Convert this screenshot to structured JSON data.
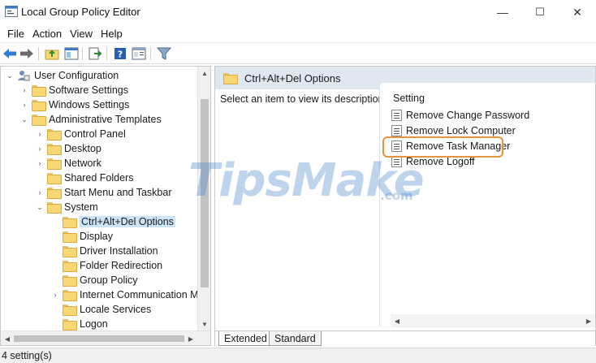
{
  "window": {
    "title": "Local Group Policy Editor",
    "minimize_glyph": "—",
    "maximize_glyph": "☐",
    "close_glyph": "✕"
  },
  "menu": {
    "file": "File",
    "action": "Action",
    "view": "View",
    "help": "Help"
  },
  "toolbar": {
    "icons": [
      "back-arrow-icon",
      "forward-arrow-icon",
      "up-folder-icon",
      "show-hide-tree-icon",
      "export-list-icon",
      "help-icon",
      "properties-icon",
      "filter-icon"
    ]
  },
  "tree": {
    "items": [
      {
        "label": "User Configuration",
        "expander": "⌄"
      },
      {
        "label": "Software Settings",
        "expander": "›"
      },
      {
        "label": "Windows Settings",
        "expander": "›"
      },
      {
        "label": "Administrative Templates",
        "expander": "⌄"
      },
      {
        "label": "Control Panel",
        "expander": "›"
      },
      {
        "label": "Desktop",
        "expander": "›"
      },
      {
        "label": "Network",
        "expander": "›"
      },
      {
        "label": "Shared Folders",
        "expander": ""
      },
      {
        "label": "Start Menu and Taskbar",
        "expander": "›"
      },
      {
        "label": "System",
        "expander": "⌄"
      },
      {
        "label": "Ctrl+Alt+Del Options",
        "expander": ""
      },
      {
        "label": "Display",
        "expander": ""
      },
      {
        "label": "Driver Installation",
        "expander": ""
      },
      {
        "label": "Folder Redirection",
        "expander": ""
      },
      {
        "label": "Group Policy",
        "expander": ""
      },
      {
        "label": "Internet Communication Ma",
        "expander": "›"
      },
      {
        "label": "Locale Services",
        "expander": ""
      },
      {
        "label": "Logon",
        "expander": ""
      }
    ]
  },
  "right": {
    "header_title": "Ctrl+Alt+Del Options",
    "description_hint": "Select an item to view its description.",
    "column_header": "Setting",
    "settings": [
      "Remove Change Password",
      "Remove Lock Computer",
      "Remove Task Manager",
      "Remove Logoff"
    ],
    "highlight_color": "#e2953a"
  },
  "tabs": {
    "extended": "Extended",
    "standard": "Standard"
  },
  "status": {
    "text": "4 setting(s)"
  },
  "watermark": {
    "brand": "TipsMake",
    "suffix": ".com"
  }
}
